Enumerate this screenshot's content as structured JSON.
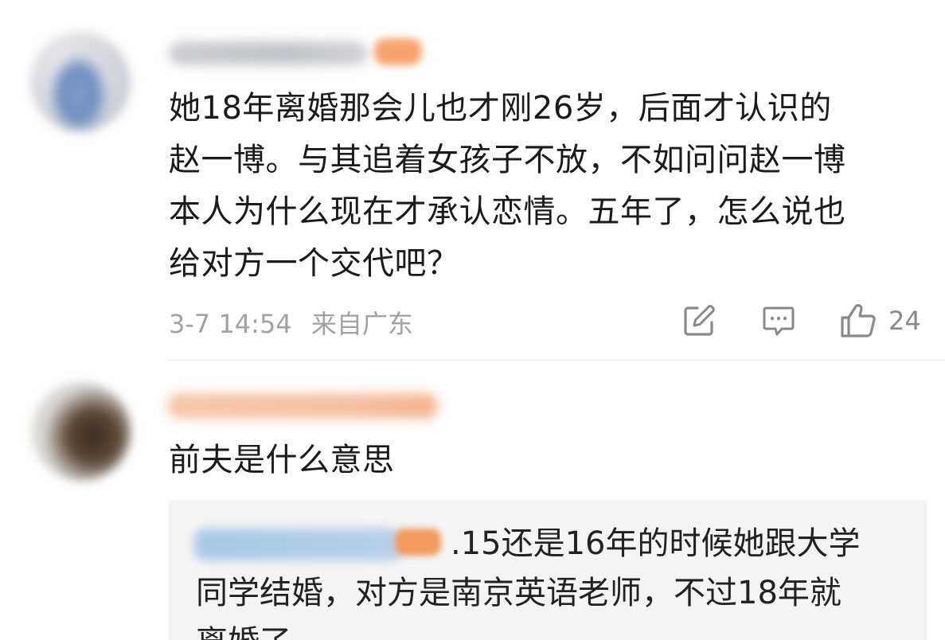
{
  "comments": [
    {
      "text_lines": [
        "她18年离婚那会儿也才刚26岁，后面才认识的",
        "赵一博。与其追着女孩子不放，不如问问赵一博",
        "本人为什么现在才承认恋情。五年了，怎么说也",
        "给对方一个交代吧？"
      ],
      "date": "3-7 14:54",
      "location": "来自广东",
      "like_count": "24",
      "icons": {
        "share": "share-icon",
        "comment": "comment-icon",
        "like": "thumbs-up-icon"
      }
    },
    {
      "text_lines": [
        "前夫是什么意思"
      ],
      "reply": {
        "text_lines": [
          ".15还是16年的时候她跟大学",
          "同学结婚，对方是南京英语老师，不过18年就",
          "离婚了"
        ]
      }
    }
  ],
  "colors": {
    "text": "#1b1b1b",
    "meta": "#a2a2a2",
    "icon": "#8a8a8a",
    "reply_bg": "#f4f4f4",
    "divider": "#ececec",
    "vip_orange": "#f7a36e"
  }
}
